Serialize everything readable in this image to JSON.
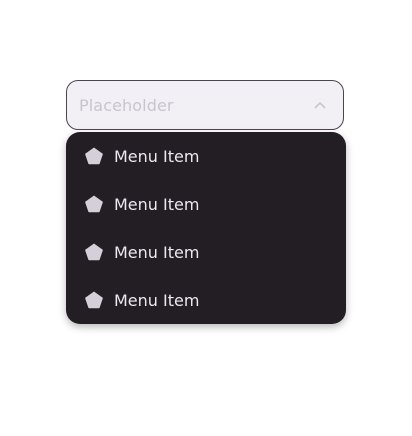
{
  "select": {
    "placeholder": "Placeholder",
    "chevron_icon": "chevron-up-icon",
    "expanded": true
  },
  "menu": {
    "items": [
      {
        "label": "Menu Item",
        "icon": "pentagon-icon"
      },
      {
        "label": "Menu Item",
        "icon": "pentagon-icon"
      },
      {
        "label": "Menu Item",
        "icon": "pentagon-icon"
      },
      {
        "label": "Menu Item",
        "icon": "pentagon-icon"
      }
    ]
  },
  "colors": {
    "trigger_background": "#f2eff5",
    "trigger_border": "#4a4550",
    "placeholder_text": "#c9c5cf",
    "menu_background": "#221e24",
    "menu_text": "#ece8f0",
    "icon_fill": "#d4cfd9"
  }
}
